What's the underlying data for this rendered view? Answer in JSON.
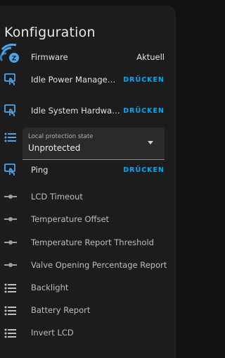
{
  "page": {
    "title": "Konfiguration"
  },
  "colors": {
    "accent": "#03a9f4",
    "icon": "#4fa3e8",
    "slider_icon": "#9e9e9e"
  },
  "rows": {
    "firmware": {
      "label": "Firmware",
      "value": "Aktuell",
      "icon": "zwave-firmware-icon"
    },
    "idle_power": {
      "label": "Idle Power Managemen…",
      "button": "DRÜCKEN",
      "icon": "touch-app-icon"
    },
    "idle_system": {
      "label": "Idle System Hardware s…",
      "button": "DRÜCKEN",
      "icon": "touch-app-icon"
    },
    "local_protection": {
      "label": "Local protection state",
      "value": "Unprotected",
      "icon": "format-list-bulleted-icon"
    },
    "ping": {
      "label": "Ping",
      "button": "DRÜCKEN",
      "icon": "touch-app-icon"
    },
    "lcd_timeout": {
      "label": "LCD Timeout",
      "icon": "slider-icon"
    },
    "temperature_offset": {
      "label": "Temperature Offset",
      "icon": "slider-icon"
    },
    "temperature_report_threshold": {
      "label": "Temperature Report Threshold",
      "icon": "slider-icon"
    },
    "valve_opening_report": {
      "label": "Valve Opening Percentage Report",
      "icon": "slider-icon"
    },
    "backlight": {
      "label": "Backlight",
      "icon": "format-list-bulleted-icon"
    },
    "battery_report": {
      "label": "Battery Report",
      "icon": "format-list-bulleted-icon"
    },
    "invert_lcd": {
      "label": "Invert LCD",
      "icon": "format-list-bulleted-icon"
    }
  }
}
